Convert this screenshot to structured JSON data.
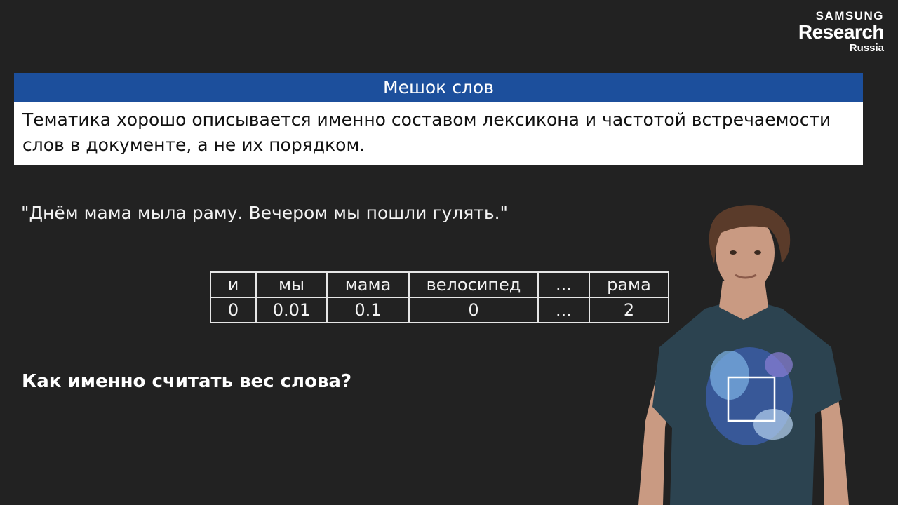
{
  "logo": {
    "line1": "SAMSUNG",
    "line2": "Research",
    "line3": "Russia"
  },
  "block": {
    "title": "Мешок слов",
    "line1": "Тематика хорошо описывается именно составом лексикона и частотой встречаемости",
    "line2": "слов в документе, а не их порядком."
  },
  "quote": "\"Днём мама мыла раму.  Вечером мы пошли гулять.\"",
  "table": {
    "headers": [
      "и",
      "мы",
      "мама",
      "велосипед",
      "...",
      "рама"
    ],
    "values": [
      "0",
      "0.01",
      "0.1",
      "0",
      "...",
      "2"
    ]
  },
  "question": "Как именно считать вес слова?",
  "colors": {
    "background": "#222222",
    "block_title": "#1c4f9c",
    "block_body": "#ffffff"
  }
}
